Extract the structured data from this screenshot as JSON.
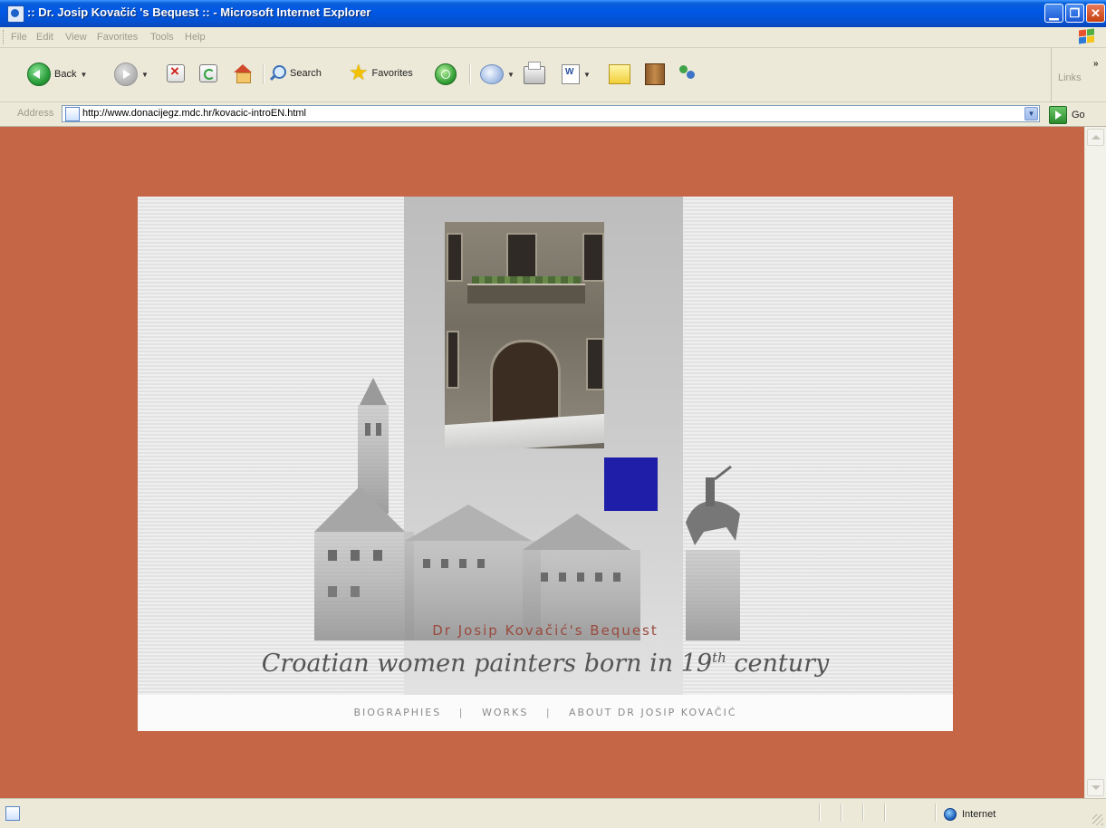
{
  "window": {
    "title": ":: Dr. Josip Kovačić 's Bequest :: - Microsoft Internet Explorer",
    "minimize": "▁",
    "maximize": "❐",
    "close": "✕"
  },
  "menu": [
    "File",
    "Edit",
    "View",
    "Favorites",
    "Tools",
    "Help"
  ],
  "toolbar": {
    "back_label": "Back",
    "search_label": "Search",
    "favorites_label": "Favorites",
    "links_label": "Links",
    "overflow": "»"
  },
  "address": {
    "label": "Address",
    "url": "http://www.donacijegz.mdc.hr/kovacic-introEN.html",
    "go_label": "Go"
  },
  "page": {
    "bequest_title": "Dr Josip Kovačić's Bequest",
    "subtitle_main": "Croatian women painters born in 19",
    "subtitle_sup": "th",
    "subtitle_end": " century",
    "nav": [
      {
        "label": "BIOGRAPHIES"
      },
      {
        "label": "WORKS"
      },
      {
        "label": "ABOUT DR JOSIP KOVAČIĆ"
      }
    ],
    "nav_separator": "|"
  },
  "status": {
    "zone": "Internet"
  },
  "colors": {
    "page_background": "#c56747",
    "accent_blue_square": "#1e1ea8",
    "title_color": "#9a4a3d"
  }
}
